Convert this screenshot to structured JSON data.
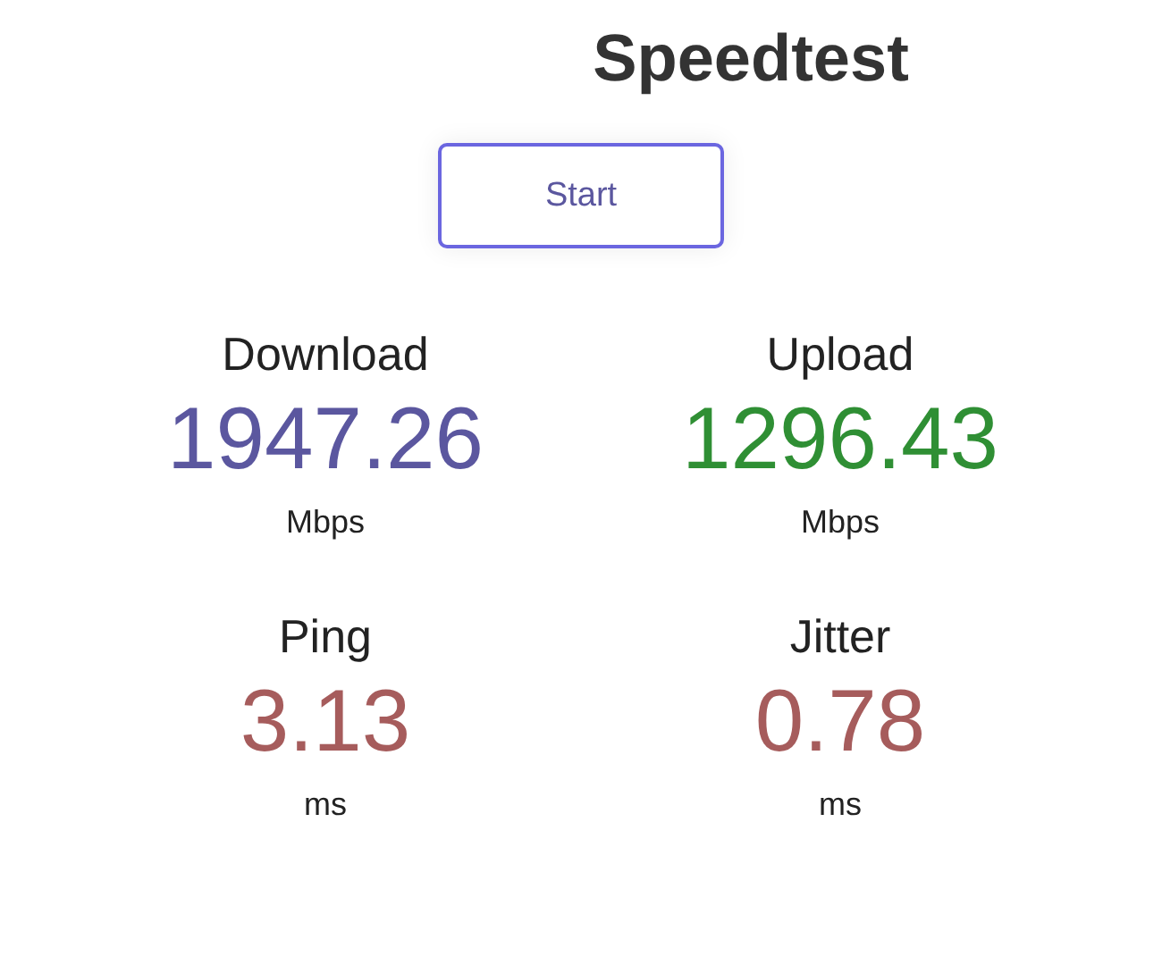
{
  "title": "Speedtest",
  "start_button": {
    "label": "Start"
  },
  "metrics": [
    {
      "label": "Download",
      "value": "1947.26",
      "unit": "Mbps",
      "color": "#5b579f"
    },
    {
      "label": "Upload",
      "value": "1296.43",
      "unit": "Mbps",
      "color": "#2f8f34"
    },
    {
      "label": "Ping",
      "value": "3.13",
      "unit": "ms",
      "color": "#a65c5c"
    },
    {
      "label": "Jitter",
      "value": "0.78",
      "unit": "ms",
      "color": "#a65c5c"
    }
  ]
}
